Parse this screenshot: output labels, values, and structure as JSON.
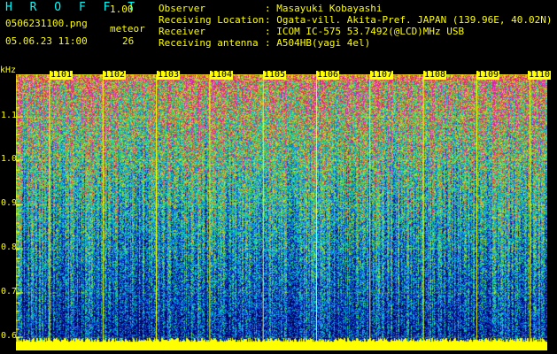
{
  "brand": {
    "name": "H R O F F T",
    "version": "1.00"
  },
  "file": {
    "name": "0506231100.png",
    "timestamp": "05.06.23 11:00"
  },
  "meteor": {
    "label": "meteor",
    "count": "26"
  },
  "info": [
    {
      "label": "Observer",
      "value": ": Masayuki Kobayashi"
    },
    {
      "label": "Receiving Location",
      "value": ": Ogata-vill. Akita-Pref. JAPAN (139.96E, 40.02N)"
    },
    {
      "label": "Receiver",
      "value": ": ICOM IC-575 53.7492(@LCD)MHz USB"
    },
    {
      "label": "Receiving antenna",
      "value": ": A504HB(yagi 4el)"
    }
  ],
  "axis": {
    "unit": "kHz",
    "y_ticks": [
      "1.1",
      "1.0",
      "0.9",
      "0.8",
      "0.7",
      "0.6"
    ],
    "time_labels": [
      "1101",
      "1102",
      "1103",
      "1104",
      "1105",
      "1106",
      "1107",
      "1108",
      "1109",
      "1110"
    ]
  },
  "colors": {
    "text": "#ffff00",
    "brand": "#00ffff",
    "grid": "#ffff00",
    "background": "#000000"
  }
}
